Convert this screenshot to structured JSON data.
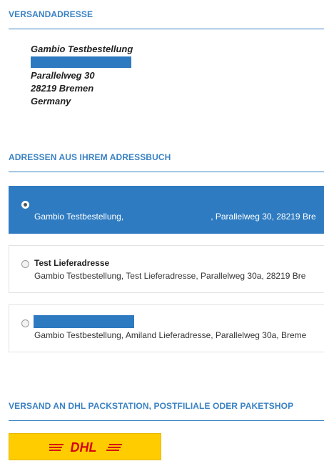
{
  "shipping": {
    "heading": "VERSANDADRESSE",
    "name": "Gambio Testbestellung",
    "street": "Parallelweg 30",
    "city": "28219 Bremen",
    "country": "Germany"
  },
  "addressbook": {
    "heading": "ADRESSEN AUS IHREM ADRESSBUCH",
    "entries": [
      {
        "title": "",
        "line_before": "Gambio Testbestellung,",
        "line_after": ", Parallelweg 30, 28219 Bre",
        "selected": true
      },
      {
        "title": "Test Lieferadresse",
        "line": "Gambio Testbestellung, Test Lieferadresse, Parallelweg 30a, 28219 Bre",
        "selected": false
      },
      {
        "title": "",
        "line": "Gambio Testbestellung, Amiland Lieferadresse, Parallelweg 30a, Breme",
        "selected": false
      }
    ]
  },
  "packstation": {
    "heading": "VERSAND AN DHL PACKSTATION, POSTFILIALE ODER PAKETSHOP",
    "logo_text": "DHL"
  },
  "colors": {
    "accent": "#3a82c4",
    "selected": "#2e7bc1",
    "dhl_yellow": "#ffcc00",
    "dhl_red": "#d40511"
  }
}
